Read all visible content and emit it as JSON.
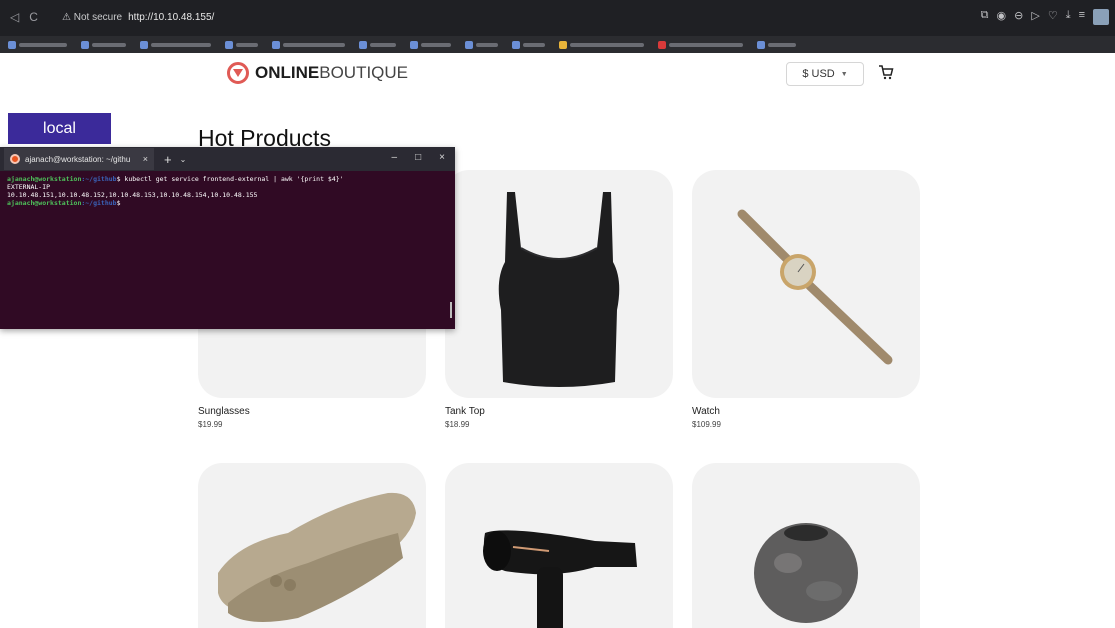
{
  "browser": {
    "nav": {
      "back": "◁",
      "forward": "▷",
      "reload": "C"
    },
    "security_label": "⚠ Not secure",
    "url": "http://10.10.48.155/",
    "toolbar_icons": [
      "share-icon",
      "camera-icon",
      "minus-circle-icon",
      "play-icon",
      "heart-icon",
      "download-icon",
      "menu-icon",
      "profile-avatar"
    ]
  },
  "header": {
    "logo_bold": "ONLINE",
    "logo_light": "BOUTIQUE",
    "currency": "$ USD",
    "currency_caret": "▼"
  },
  "environment_badge": "local",
  "section_title": "Hot Products",
  "products": [
    {
      "name": "Sunglasses",
      "price": "$19.99"
    },
    {
      "name": "Tank Top",
      "price": "$18.99"
    },
    {
      "name": "Watch",
      "price": "$109.99"
    },
    {
      "name": "",
      "price": ""
    },
    {
      "name": "",
      "price": ""
    },
    {
      "name": "",
      "price": ""
    }
  ],
  "terminal": {
    "tab_title": "ajanach@workstation: ~/githu",
    "tab_close": "×",
    "new_tab": "+",
    "dropdown": "⌄",
    "minimize": "–",
    "maximize": "□",
    "close": "×",
    "prompt_user": "ajanach@workstation",
    "prompt_path": ":~/github",
    "command": "$ kubectl get service frontend-external | awk '{print $4}'",
    "output_header": "EXTERNAL-IP",
    "output_value": "10.10.48.151,10.10.48.152,10.10.48.153,10.10.48.154,10.10.48.155",
    "prompt2_user": "ajanach@workstation",
    "prompt2_path": ":~/github",
    "prompt2_end": "$"
  },
  "colors": {
    "brand_red": "#e05a55",
    "badge_purple": "#3b2a9a",
    "terminal_bg": "#300a24"
  }
}
